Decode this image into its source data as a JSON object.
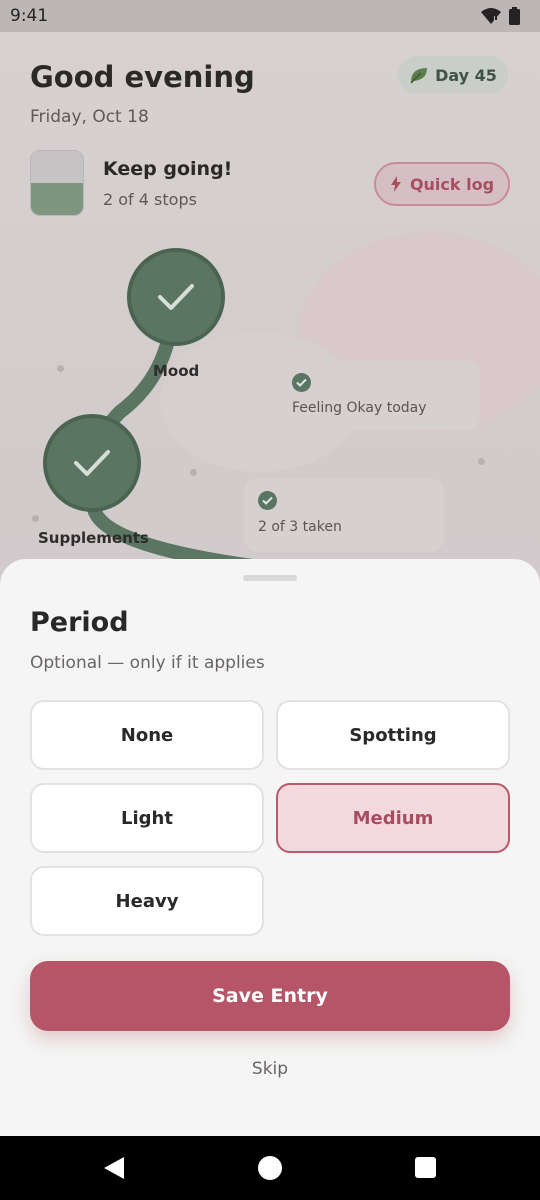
{
  "status_bar": {
    "time": "9:41"
  },
  "header": {
    "greeting": "Good evening",
    "date": "Friday, Oct 18",
    "day_badge": {
      "label": "Day 45",
      "icon": "leaf-icon"
    }
  },
  "progress": {
    "title": "Keep going!",
    "subtitle": "2 of 4 stops",
    "completed_fraction": 0.5,
    "quick_log_label": "Quick log"
  },
  "journey": {
    "stops": [
      {
        "label": "Mood",
        "done": true,
        "detail": "Feeling Okay today"
      },
      {
        "label": "Supplements",
        "done": true,
        "detail": "2 of 3 taken"
      }
    ]
  },
  "sheet": {
    "title": "Period",
    "subtitle": "Optional — only if it applies",
    "options": [
      "None",
      "Spotting",
      "Light",
      "Medium",
      "Heavy"
    ],
    "selected": "Medium",
    "save_label": "Save Entry",
    "skip_label": "Skip"
  },
  "colors": {
    "accent": "#b55567",
    "green": "#5a7561",
    "selected_bg": "#f3d9de"
  }
}
